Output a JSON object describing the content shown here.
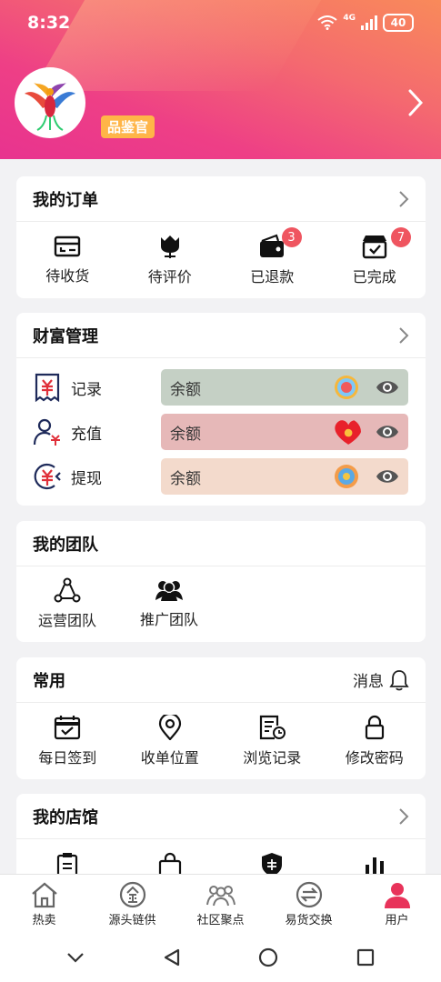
{
  "status_bar": {
    "time": "8:32",
    "network": "4G",
    "battery": "40"
  },
  "profile": {
    "role_badge": "品鉴官"
  },
  "orders": {
    "title": "我的订单",
    "items": [
      {
        "label": "待收货",
        "icon": "delivery-icon"
      },
      {
        "label": "待评价",
        "icon": "flower-icon"
      },
      {
        "label": "已退款",
        "icon": "wallet-icon",
        "badge": "3"
      },
      {
        "label": "已完成",
        "icon": "box-check-icon",
        "badge": "7"
      }
    ]
  },
  "wealth": {
    "title": "财富管理",
    "rows": [
      {
        "label": "记录",
        "icon": "receipt-yuan-icon",
        "bar_text": "余额",
        "bar_color": "#c5d0c5",
        "medal": "medal-badge-1"
      },
      {
        "label": "充值",
        "icon": "user-yuan-icon",
        "bar_text": "余额",
        "bar_color": "#e6b8b8",
        "medal": "heart-badge"
      },
      {
        "label": "提现",
        "icon": "withdraw-yuan-icon",
        "bar_text": "余额",
        "bar_color": "#f3dacc",
        "medal": "medal-badge-2"
      }
    ]
  },
  "team": {
    "title": "我的团队",
    "items": [
      {
        "label": "运营团队",
        "icon": "network-icon"
      },
      {
        "label": "推广团队",
        "icon": "people-icon"
      }
    ]
  },
  "common": {
    "title": "常用",
    "message_label": "消息",
    "items": [
      {
        "label": "每日签到",
        "icon": "calendar-check-icon"
      },
      {
        "label": "收单位置",
        "icon": "location-pin-icon"
      },
      {
        "label": "浏览记录",
        "icon": "history-doc-icon"
      },
      {
        "label": "修改密码",
        "icon": "lock-icon"
      }
    ]
  },
  "shop": {
    "title": "我的店馆"
  },
  "bottom_nav": [
    {
      "label": "热卖",
      "icon": "home-icon",
      "active": false
    },
    {
      "label": "源头链供",
      "icon": "enterprise-icon",
      "active": false
    },
    {
      "label": "社区聚点",
      "icon": "community-icon",
      "active": false
    },
    {
      "label": "易货交换",
      "icon": "exchange-icon",
      "active": false
    },
    {
      "label": "用户",
      "icon": "user-icon",
      "active": true
    }
  ],
  "colors": {
    "accent": "#e8338f",
    "badge": "#ef5560",
    "role_badge": "#ffb548",
    "active_tab": "#e8335a"
  }
}
